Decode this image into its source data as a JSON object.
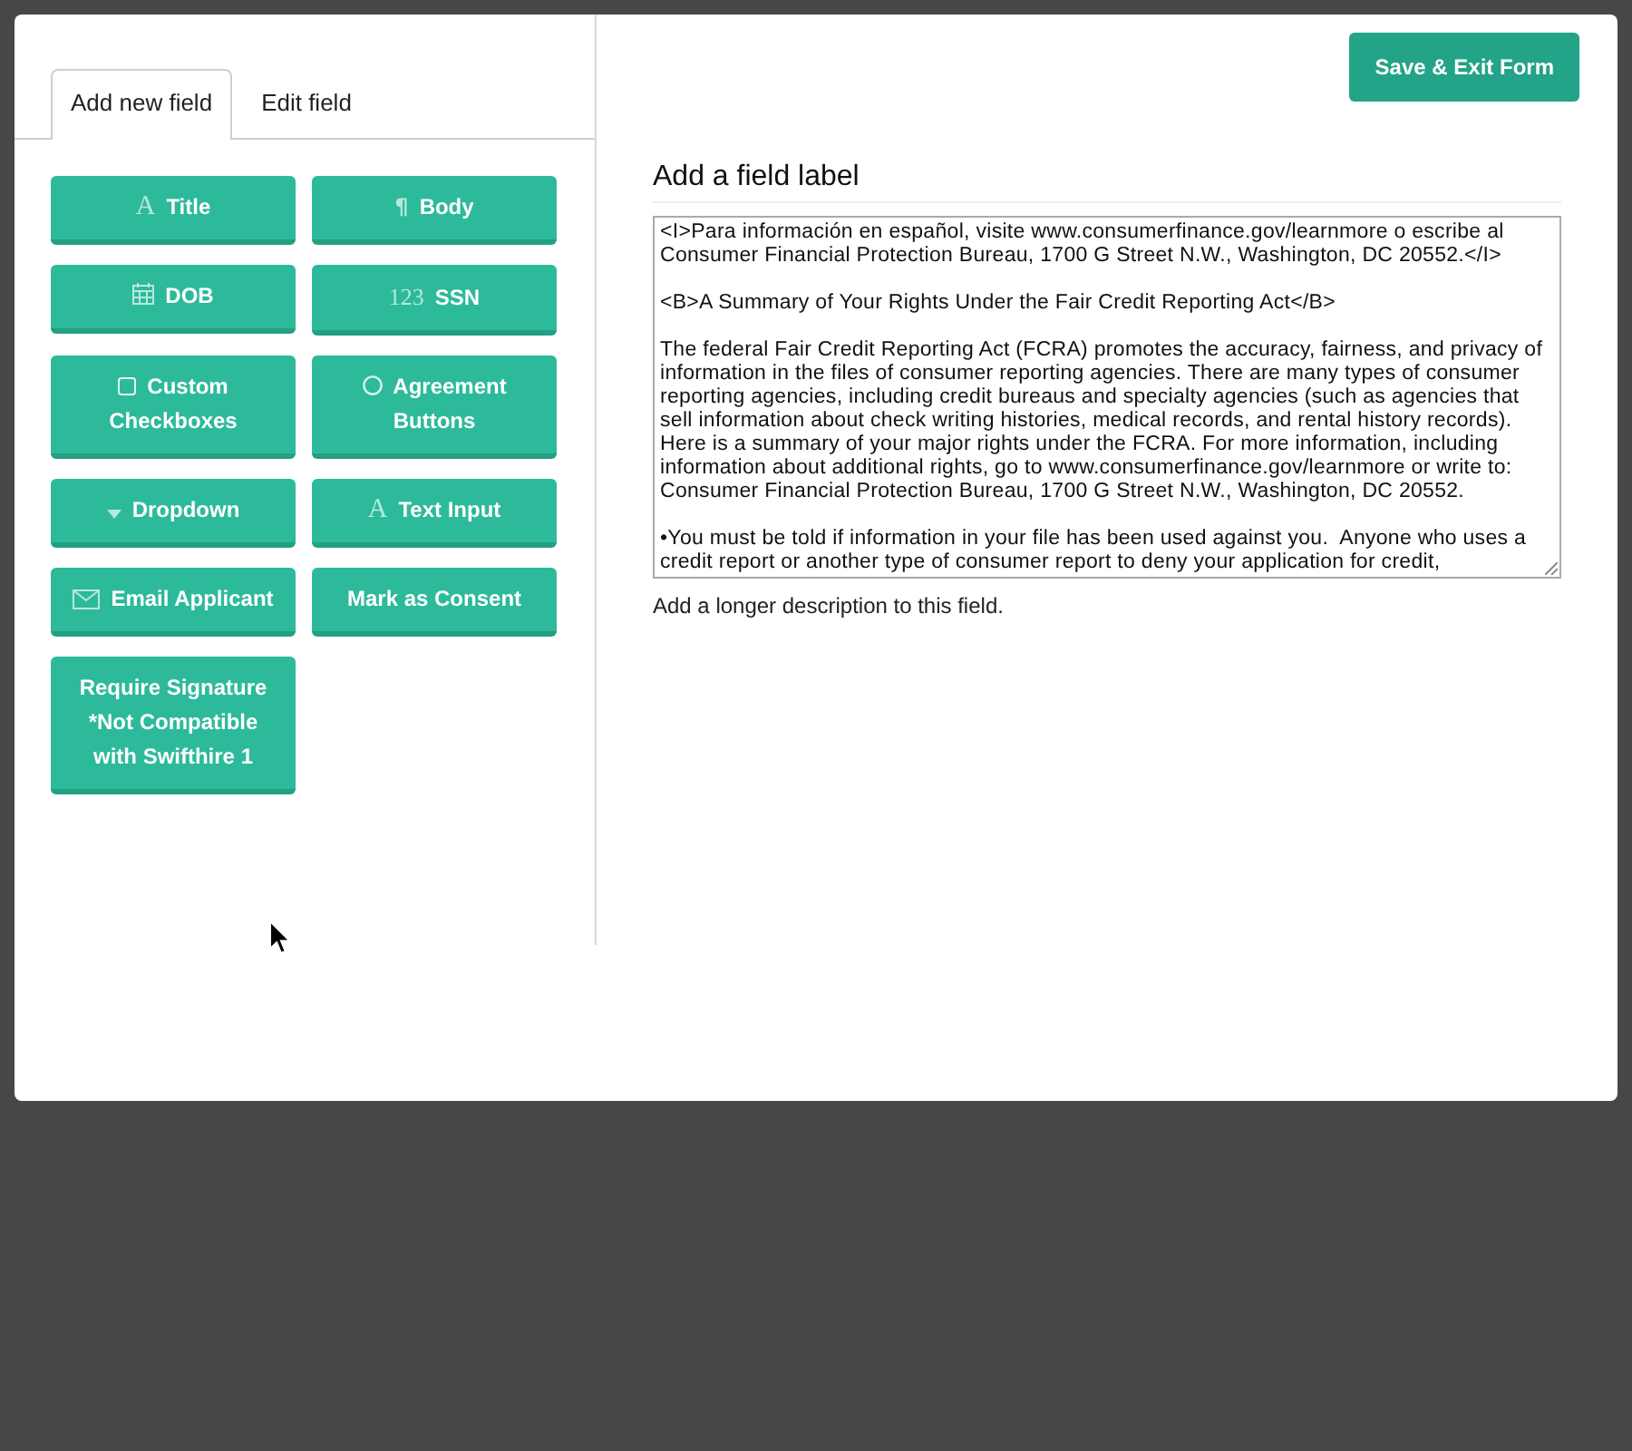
{
  "tabs": [
    {
      "label": "Add new field",
      "selected": true
    },
    {
      "label": "Edit field",
      "selected": false
    }
  ],
  "field_buttons": [
    {
      "label": "Title",
      "icon": {
        "kind": "letter",
        "text": "A"
      }
    },
    {
      "label": "Body",
      "icon": {
        "kind": "pilcrow",
        "text": "¶"
      }
    },
    {
      "label": "DOB",
      "icon": {
        "kind": "calendar"
      }
    },
    {
      "label": "SSN",
      "icon": {
        "kind": "digits",
        "text": "123"
      }
    },
    {
      "label": "Custom Checkboxes",
      "icon": {
        "kind": "checkbox"
      }
    },
    {
      "label": "Agreement Buttons",
      "icon": {
        "kind": "radio"
      }
    },
    {
      "label": "Dropdown",
      "icon": {
        "kind": "caret"
      }
    },
    {
      "label": "Text Input",
      "icon": {
        "kind": "letter",
        "text": "A"
      }
    },
    {
      "label": "Email Applicant",
      "icon": {
        "kind": "envelope"
      }
    },
    {
      "label": "Mark as Consent"
    },
    {
      "label": "Require Signature *Not Compatible with Swifthire 1"
    }
  ],
  "save_button": {
    "label": "Save & Exit Form"
  },
  "field_label": {
    "text": "Add a field label"
  },
  "description": {
    "value": "<I>Para información en español, visite www.consumerfinance.gov/learnmore o escribe al Consumer Financial Protection Bureau, 1700 G Street N.W., Washington, DC 20552.</I>\n\n<B>A Summary of Your Rights Under the Fair Credit Reporting Act</B>\n\nThe federal Fair Credit Reporting Act (FCRA) promotes the accuracy, fairness, and privacy of information in the files of consumer reporting agencies. There are many types of consumer reporting agencies, including credit bureaus and specialty agencies (such as agencies that sell information about check writing histories, medical records, and rental history records). Here is a summary of your major rights under the FCRA. For more information, including information about additional rights, go to www.consumerfinance.gov/learnmore or write to: Consumer Financial Protection Bureau, 1700 G Street N.W., Washington, DC 20552.\n\n•You must be told if information in your file has been used against you.  Anyone who uses a credit report or another type of consumer report to deny your application for credit,",
    "help": "Add a longer description to this field."
  }
}
